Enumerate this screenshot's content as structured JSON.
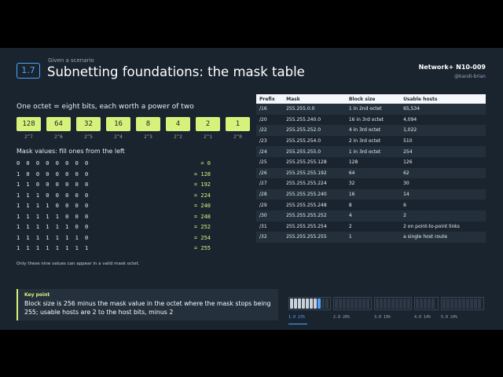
{
  "header": {
    "section": "1.7",
    "kicker": "Given a scenario",
    "title": "Subnetting foundations: the mask table",
    "course": "Network+ N10-009",
    "handle": "@kandi-brian"
  },
  "bits": {
    "heading": "One octet = eight bits, each worth a power of two",
    "values": [
      "128",
      "64",
      "32",
      "16",
      "8",
      "4",
      "2",
      "1"
    ],
    "labels": [
      "2^7",
      "2^6",
      "2^5",
      "2^4",
      "2^3",
      "2^2",
      "2^1",
      "2^0"
    ]
  },
  "mask_values": {
    "heading": "Mask values: fill ones from the left",
    "rows": [
      {
        "bits": "0 0 0 0 0 0 0 0",
        "value": "= 0"
      },
      {
        "bits": "1 0 0 0 0 0 0 0",
        "value": "= 128"
      },
      {
        "bits": "1 1 0 0 0 0 0 0",
        "value": "= 192"
      },
      {
        "bits": "1 1 1 0 0 0 0 0",
        "value": "= 224"
      },
      {
        "bits": "1 1 1 1 0 0 0 0",
        "value": "= 240"
      },
      {
        "bits": "1 1 1 1 1 0 0 0",
        "value": "= 248"
      },
      {
        "bits": "1 1 1 1 1 1 0 0",
        "value": "= 252"
      },
      {
        "bits": "1 1 1 1 1 1 1 0",
        "value": "= 254"
      },
      {
        "bits": "1 1 1 1 1 1 1 1",
        "value": "= 255"
      }
    ],
    "note": "Only these nine values can appear in a valid mask octet."
  },
  "key_point": {
    "title": "Key point",
    "text": "Block size is 256 minus the mask value in the octet where the mask stops being 255; usable hosts are 2 to the host bits, minus 2"
  },
  "table": {
    "headers": [
      "Prefix",
      "Mask",
      "Block size",
      "Usable hosts"
    ],
    "rows": [
      [
        "/16",
        "255.255.0.0",
        "1 in 2nd octet",
        "65,534"
      ],
      [
        "/20",
        "255.255.240.0",
        "16 in 3rd octet",
        "4,094"
      ],
      [
        "/22",
        "255.255.252.0",
        "4 in 3rd octet",
        "1,022"
      ],
      [
        "/23",
        "255.255.254.0",
        "2 in 3rd octet",
        "510"
      ],
      [
        "/24",
        "255.255.255.0",
        "1 in 3rd octet",
        "254"
      ],
      [
        "/25",
        "255.255.255.128",
        "128",
        "126"
      ],
      [
        "/26",
        "255.255.255.192",
        "64",
        "62"
      ],
      [
        "/27",
        "255.255.255.224",
        "32",
        "30"
      ],
      [
        "/28",
        "255.255.255.240",
        "16",
        "14"
      ],
      [
        "/29",
        "255.255.255.248",
        "8",
        "6"
      ],
      [
        "/30",
        "255.255.255.252",
        "4",
        "2"
      ],
      [
        "/31",
        "255.255.255.254",
        "2",
        "2 on point-to-point links"
      ],
      [
        "/32",
        "255.255.255.255",
        "1",
        "a single host route"
      ]
    ]
  },
  "progress": {
    "groups": [
      {
        "label": "1.0  23%",
        "active": true,
        "fraction": 0.23
      },
      {
        "label": "2.0  20%",
        "active": false,
        "fraction": 0.2
      },
      {
        "label": "3.0  19%",
        "active": false,
        "fraction": 0.19
      },
      {
        "label": "4.0  14%",
        "active": false,
        "fraction": 0.14
      },
      {
        "label": "5.0  24%",
        "active": false,
        "fraction": 0.24
      }
    ]
  },
  "colors": {
    "background": "#1a242f",
    "accent": "#d7f27c",
    "highlight": "#4ea3ff"
  }
}
